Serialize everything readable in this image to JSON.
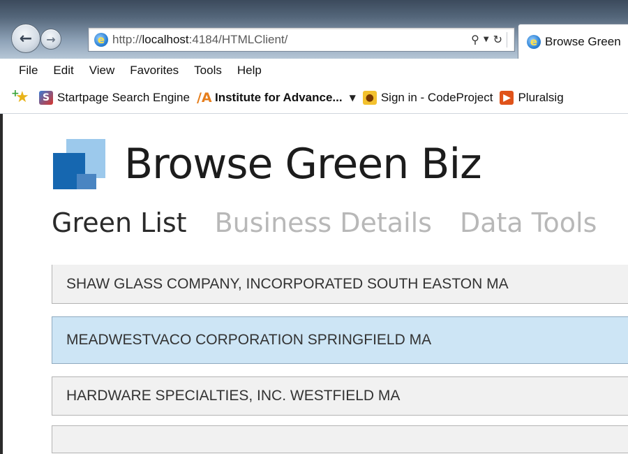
{
  "browser": {
    "address_prefix": "http://",
    "address_host": "localhost",
    "address_suffix": ":4184/HTMLClient/",
    "tab_title": "Browse Green",
    "menu": [
      "File",
      "Edit",
      "View",
      "Favorites",
      "Tools",
      "Help"
    ],
    "favorites": [
      {
        "label": "Startpage Search Engine",
        "icon": "startpage-icon",
        "bold": false
      },
      {
        "label": "Institute for Advance...",
        "icon": "iaa-icon",
        "bold": true
      },
      {
        "label": "Sign in - CodeProject",
        "icon": "codeproject-icon",
        "bold": false
      },
      {
        "label": "Pluralsig",
        "icon": "pluralsight-icon",
        "bold": false
      }
    ]
  },
  "app": {
    "title": "Browse Green Biz",
    "tabs": [
      {
        "label": "Green List",
        "active": true
      },
      {
        "label": "Business Details",
        "active": false
      },
      {
        "label": "Data Tools",
        "active": false
      }
    ],
    "list": [
      {
        "label": "SHAW GLASS COMPANY, INCORPORATED SOUTH EASTON MA",
        "selected": false
      },
      {
        "label": "MEADWESTVACO CORPORATION SPRINGFIELD MA",
        "selected": true
      },
      {
        "label": "HARDWARE SPECIALTIES, INC. WESTFIELD MA",
        "selected": false
      },
      {
        "label": "",
        "selected": false
      }
    ]
  },
  "colors": {
    "selected_row": "#cde5f5",
    "row": "#f1f1f1",
    "logo_dark": "#1667b0",
    "logo_light": "#9cc9ec"
  }
}
